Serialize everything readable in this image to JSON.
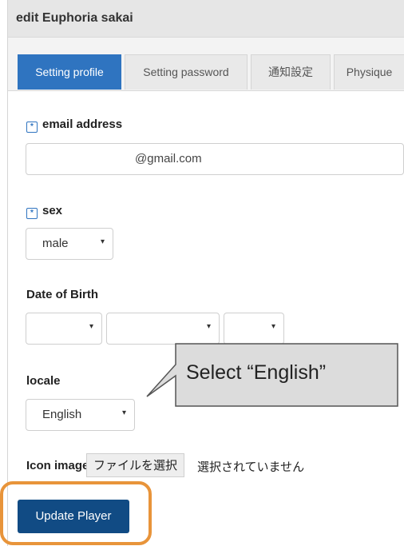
{
  "header": {
    "title": "edit Euphoria sakai"
  },
  "tabs": [
    {
      "label": "Setting profile",
      "active": true
    },
    {
      "label": "Setting password",
      "active": false
    },
    {
      "label": "通知設定",
      "active": false
    },
    {
      "label": "Physique",
      "active": false
    }
  ],
  "form": {
    "required_mark": "*",
    "email": {
      "label": "email address",
      "value": "@gmail.com"
    },
    "sex": {
      "label": "sex",
      "selected": "male"
    },
    "dob": {
      "label": "Date of Birth",
      "year": "",
      "month": "",
      "day": ""
    },
    "locale": {
      "label": "locale",
      "selected": "English"
    },
    "icon": {
      "label": "Icon image",
      "button": "ファイルを選択",
      "status": "選択されていません"
    },
    "submit": "Update Player"
  },
  "callout": {
    "text": "Select “English”"
  },
  "icons": {
    "caret": "▾"
  },
  "colors": {
    "accent": "#2f74c0",
    "submit": "#114b84",
    "highlight": "#e8943a",
    "callout_bg": "#dcdcdc"
  }
}
